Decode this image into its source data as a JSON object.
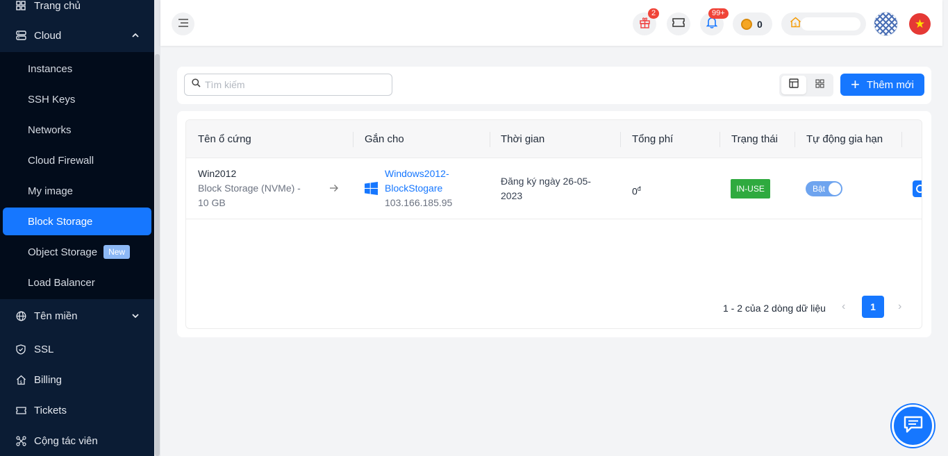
{
  "sidebar": {
    "items": [
      {
        "label": "Trang chủ",
        "icon": "grid-icon"
      },
      {
        "label": "Cloud",
        "icon": "server-icon"
      },
      {
        "label": "Tên miền",
        "icon": "globe-icon"
      },
      {
        "label": "SSL",
        "icon": "shield-icon"
      },
      {
        "label": "Billing",
        "icon": "home-money-icon"
      },
      {
        "label": "Tickets",
        "icon": "ticket-icon"
      },
      {
        "label": "Cộng tác viên",
        "icon": "network-icon"
      }
    ],
    "cloud_submenu": [
      {
        "label": "Instances"
      },
      {
        "label": "SSH Keys"
      },
      {
        "label": "Networks"
      },
      {
        "label": "Cloud Firewall"
      },
      {
        "label": "My image"
      },
      {
        "label": "Block Storage",
        "active": true
      },
      {
        "label": "Object Storage",
        "badge": "New"
      },
      {
        "label": "Load Balancer"
      }
    ]
  },
  "header": {
    "gift_count": "2",
    "notification_count": "99+",
    "coin_balance": "0",
    "accent": "#1677ff"
  },
  "toolbar": {
    "search_placeholder": "Tìm kiếm",
    "add_label": "Thêm mới"
  },
  "table": {
    "columns": [
      "Tên ổ cứng",
      "Gắn cho",
      "Thời gian",
      "Tổng phí",
      "Trạng thái",
      "Tự động gia hạn"
    ],
    "rows": [
      {
        "name": "Win2012",
        "type_line1": "Block Storage (NVMe) -",
        "type_line2": "10 GB",
        "attached_line1": "Windows2012-",
        "attached_line2": "BlockStogare",
        "attached_ip": "103.166.185.95",
        "time_line1": "Đăng ký ngày 26-05-",
        "time_line2": "2023",
        "fee": "0",
        "fee_unit": "đ",
        "status": "IN-USE",
        "auto_renew": "Bật"
      }
    ],
    "pagination_text": "1 - 2 của 2 dòng dữ liệu",
    "current_page": "1"
  }
}
